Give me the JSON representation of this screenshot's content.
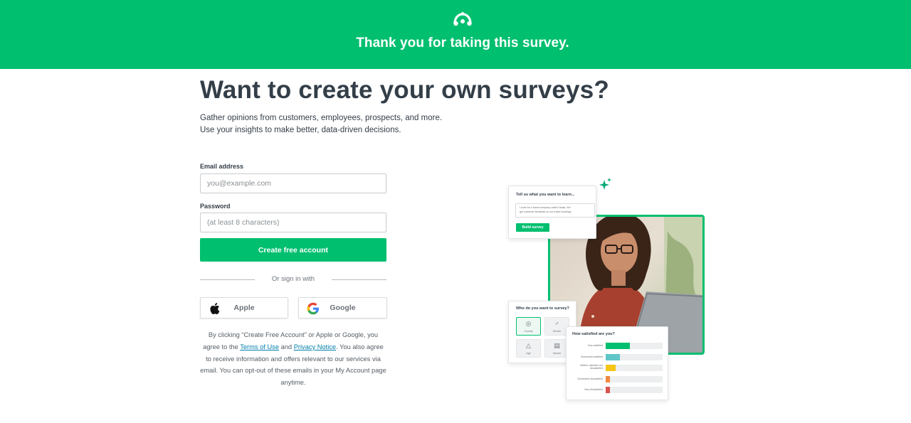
{
  "banner": {
    "logo_icon": "surveymonkey-logo-icon",
    "title": "Thank you for taking this survey.",
    "background": "#00bf6f"
  },
  "main": {
    "headline": "Want to create your own surveys?",
    "intro_line1": "Gather opinions from customers, employees, prospects, and more.",
    "intro_line2": "Use your insights to make better, data-driven decisions."
  },
  "form": {
    "email_label": "Email address",
    "email_placeholder": "you@example.com",
    "email_value": "",
    "password_label": "Password",
    "password_placeholder": "(at least 8 characters)",
    "password_value": "",
    "submit_label": "Create free account",
    "divider_text": "Or sign in with",
    "apple_label": "Apple",
    "apple_icon": "apple-icon",
    "google_label": "Google",
    "google_icon": "google-icon"
  },
  "legal": {
    "text_before": "By clicking “Create Free Account” or Apple or Google, you agree to the ",
    "terms_link": "Terms of Use",
    "and": " and ",
    "privacy_link": "Privacy Notice",
    "text_after": ". You also agree to receive information and offers relevant to our services via email. You can opt-out of these emails in your My Account page anytime."
  },
  "illustration": {
    "learn_card": {
      "title": "Tell us what you want to learn...",
      "prompt_line1": "I work for a travel company called Vivaia. We",
      "prompt_line2": "get customer feedback on our travel bookings",
      "button": "Build survey"
    },
    "who_card": {
      "title": "Who do you want to survey?",
      "options": [
        "Country",
        "Gender",
        "Age",
        "Income"
      ]
    },
    "satisfaction_card": {
      "title": "How satisfied are you?",
      "rows": [
        {
          "label": "Very satisfied",
          "value": 0.42,
          "color": "#00bf6f"
        },
        {
          "label": "Somewhat satisfied",
          "value": 0.25,
          "color": "#5fc6c9"
        },
        {
          "label": "Neither satisfied nor dissatisfied",
          "value": 0.17,
          "color": "#f5c518"
        },
        {
          "label": "Somewhat dissatisfied",
          "value": 0.08,
          "color": "#f0883e"
        },
        {
          "label": "Very dissatisfied",
          "value": 0.08,
          "color": "#d9534f"
        }
      ]
    },
    "accent": "#00bf6f"
  }
}
